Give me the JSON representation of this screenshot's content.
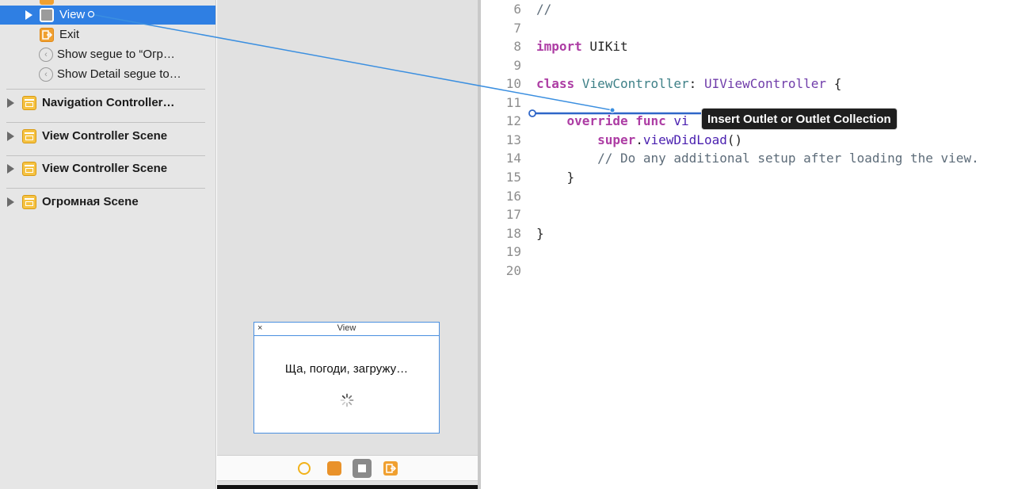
{
  "outline": {
    "items": [
      {
        "label": "View",
        "selected": true,
        "icon": "view-square-icon"
      },
      {
        "label": "Exit",
        "icon": "exit-icon"
      },
      {
        "label": "Show segue to “Огр…",
        "icon": "segue-icon"
      },
      {
        "label": "Show Detail segue to…",
        "icon": "segue-icon"
      }
    ],
    "scenes": [
      {
        "label": "Navigation Controller…",
        "icon": "scene-clapper-icon"
      },
      {
        "label": "View Controller Scene",
        "icon": "scene-clapper-icon"
      },
      {
        "label": "View Controller Scene",
        "icon": "scene-clapper-icon"
      },
      {
        "label": "Огромная Scene",
        "icon": "scene-clapper-icon"
      }
    ]
  },
  "canvas": {
    "preview": {
      "title": "View",
      "close_glyph": "×",
      "message": "Ща, погоди, загружу…"
    },
    "scene_bar_icons": [
      "view-controller-icon",
      "first-responder-icon",
      "view-square-icon",
      "exit-icon"
    ]
  },
  "editor": {
    "lines": [
      {
        "n": "6"
      },
      {
        "n": "7"
      },
      {
        "n": "8"
      },
      {
        "n": "9"
      },
      {
        "n": "10"
      },
      {
        "n": "11"
      },
      {
        "n": "12"
      },
      {
        "n": "13"
      },
      {
        "n": "14"
      },
      {
        "n": "15"
      },
      {
        "n": "16"
      },
      {
        "n": "17"
      },
      {
        "n": "18"
      },
      {
        "n": "19"
      },
      {
        "n": "20"
      }
    ],
    "tokens": {
      "l6": "//",
      "l8_kw": "import",
      "l8_mod": " UIKit",
      "l10_kw": "class",
      "l10_name": " ViewController",
      "l10_colon": ": ",
      "l10_super": "UIViewController",
      "l10_brace": " {",
      "l12_indent": "    ",
      "l12_kw1": "override",
      "l12_sp": " ",
      "l12_kw2": "func",
      "l12_fn": " vi",
      "l13_indent": "        ",
      "l13_kw": "super",
      "l13_dot": ".",
      "l13_fn": "viewDidLoad",
      "l13_paren": "()",
      "l14_comment": "        // Do any additional setup after loading the view.",
      "l15": "    }",
      "l18": "}"
    }
  },
  "tooltip": {
    "text": "Insert Outlet or Outlet Collection"
  },
  "colors": {
    "selection": "#2f7fe3",
    "connection_line": "#3b8fe0",
    "keyword": "#ad3da4",
    "type": "#3e8087",
    "system_type": "#703daa",
    "comment": "#5d6c79"
  }
}
